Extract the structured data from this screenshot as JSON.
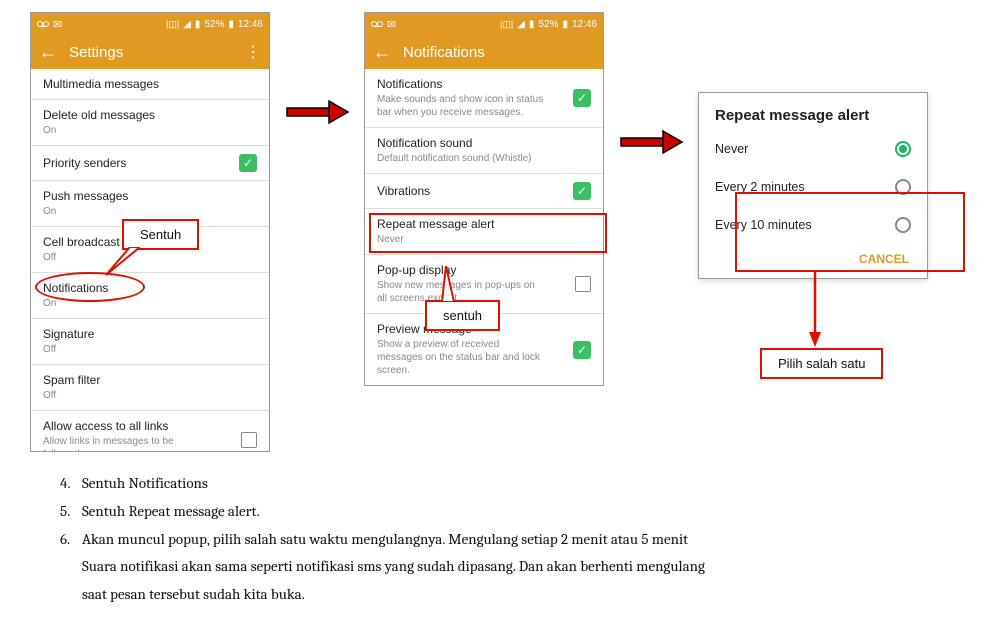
{
  "status": {
    "time": "12:46",
    "battery": "52%"
  },
  "screen1": {
    "title": "Settings",
    "items": {
      "multimedia": {
        "title": "Multimedia messages"
      },
      "delete_old": {
        "title": "Delete old messages",
        "sub": "On"
      },
      "priority": {
        "title": "Priority senders"
      },
      "push": {
        "title": "Push messages",
        "sub": "On"
      },
      "cell": {
        "title": "Cell broadcast",
        "sub": "Off"
      },
      "notifications": {
        "title": "Notifications",
        "sub": "On"
      },
      "signature": {
        "title": "Signature",
        "sub": "Off"
      },
      "spam": {
        "title": "Spam filter",
        "sub": "Off"
      },
      "allow_links": {
        "title": "Allow access to all links",
        "sub": "Allow links in messages to be followed."
      }
    }
  },
  "screen2": {
    "title": "Notifications",
    "items": {
      "notifications": {
        "title": "Notifications",
        "sub": "Make sounds and show icon in status bar when you receive messages."
      },
      "sound": {
        "title": "Notification sound",
        "sub": "Default notification sound (Whistle)"
      },
      "vibration": {
        "title": "Vibrations"
      },
      "repeat": {
        "title": "Repeat message alert",
        "sub": "Never"
      },
      "popup": {
        "title": "Pop-up display",
        "sub": "Show new messages in pop-ups on all screens except..."
      },
      "preview": {
        "title": "Preview message",
        "sub": "Show a preview of received messages on the status bar and lock screen."
      }
    }
  },
  "dialog": {
    "title": "Repeat message alert",
    "options": {
      "never": "Never",
      "two": "Every 2 minutes",
      "ten": "Every 10 minutes"
    },
    "cancel": "CANCEL"
  },
  "callouts": {
    "sentuh1": "Sentuh",
    "sentuh2": "sentuh",
    "pilih": "Pilih salah satu"
  },
  "instructions": {
    "step4": {
      "num": "4.",
      "text": "Sentuh Notifications"
    },
    "step5": {
      "num": "5.",
      "text": "Sentuh Repeat message alert."
    },
    "step6a": {
      "num": "6.",
      "text": "Akan muncul popup, pilih salah satu waktu mengulangnya. Mengulang setiap 2 menit atau 5 menit"
    },
    "step6b": "Suara notifikasi akan sama seperti notifikasi sms yang sudah dipasang. Dan akan berhenti mengulang",
    "step6c": "saat pesan tersebut sudah kita buka."
  }
}
